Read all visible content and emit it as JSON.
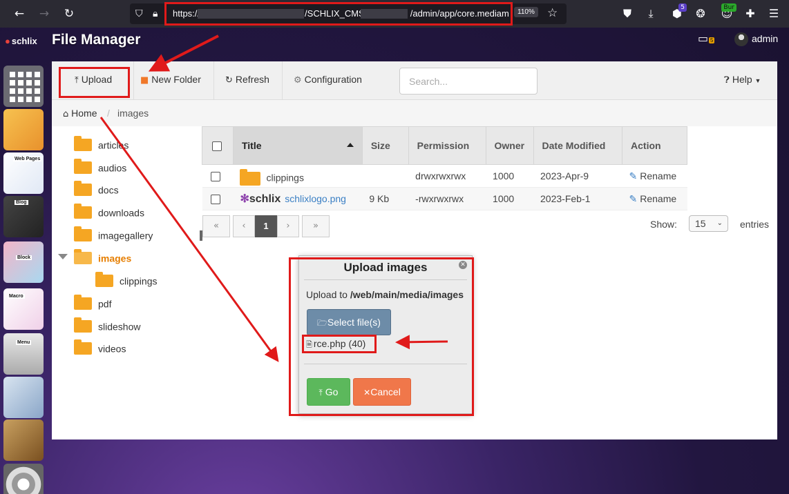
{
  "browser": {
    "url_prefix": "https://",
    "url_mid": "/SCHLIX_CMS",
    "url_suffix": "/admin/app/core.mediam",
    "zoom": "110%",
    "badges": {
      "extension_count": "5",
      "burp_label": "Bur"
    }
  },
  "app": {
    "logo_text": "schlix",
    "title": "File Manager",
    "monitor_badge": "5",
    "username": "admin"
  },
  "dock": {
    "items": [
      {
        "name": "apps",
        "label": ""
      },
      {
        "name": "file-manager",
        "label": ""
      },
      {
        "name": "web-pages",
        "label": "Web Pages"
      },
      {
        "name": "blog",
        "label": "Blog"
      },
      {
        "name": "block",
        "label": "Block"
      },
      {
        "name": "macro",
        "label": "Macro"
      },
      {
        "name": "menu",
        "label": "Menu"
      },
      {
        "name": "users",
        "label": ""
      },
      {
        "name": "tools",
        "label": ""
      },
      {
        "name": "settings",
        "label": ""
      }
    ]
  },
  "toolbar": {
    "upload_label": "Upload",
    "new_folder_label": "New Folder",
    "refresh_label": "Refresh",
    "configuration_label": "Configuration",
    "search_placeholder": "Search...",
    "help_label": "Help"
  },
  "breadcrumb": {
    "home": "Home",
    "current": "images"
  },
  "tree": {
    "items": [
      {
        "label": "articles",
        "level": 0,
        "expanded": false,
        "active": false
      },
      {
        "label": "audios",
        "level": 0,
        "expanded": false,
        "active": false
      },
      {
        "label": "docs",
        "level": 0,
        "expanded": false,
        "active": false
      },
      {
        "label": "downloads",
        "level": 0,
        "expanded": false,
        "active": false
      },
      {
        "label": "imagegallery",
        "level": 0,
        "expanded": false,
        "active": false
      },
      {
        "label": "images",
        "level": 0,
        "expanded": true,
        "active": true
      },
      {
        "label": "clippings",
        "level": 1,
        "expanded": false,
        "active": false
      },
      {
        "label": "pdf",
        "level": 0,
        "expanded": false,
        "active": false
      },
      {
        "label": "slideshow",
        "level": 0,
        "expanded": false,
        "active": false
      },
      {
        "label": "videos",
        "level": 0,
        "expanded": false,
        "active": false
      }
    ]
  },
  "table": {
    "columns": [
      "Title",
      "Size",
      "Permission",
      "Owner",
      "Date Modified",
      "Action"
    ],
    "rows": [
      {
        "type": "folder",
        "title": "clippings",
        "size": "",
        "permission": "drwxrwxrwx",
        "owner": "1000",
        "modified": "2023-Apr-9",
        "action": "Rename"
      },
      {
        "type": "image",
        "thumb_text": "schlix",
        "title": "schlixlogo.png",
        "size": "9 Kb",
        "permission": "-rwxrwxrwx",
        "owner": "1000",
        "modified": "2023-Feb-1",
        "action": "Rename"
      }
    ]
  },
  "pagination": {
    "first": "«",
    "prev": "‹",
    "current": "1",
    "next": "›",
    "last": "»",
    "show_label": "Show:",
    "page_size": "15",
    "entries_label": "entries"
  },
  "modal": {
    "title": "Upload images",
    "upload_to_prefix": "Upload to ",
    "upload_path": "/web/main/media/images",
    "select_label": "Select file(s)",
    "file_name": "rce.php (40)",
    "go_label": "Go",
    "cancel_label": "Cancel"
  },
  "colors": {
    "annotation_red": "#e01a1a",
    "folder_orange": "#f5a623",
    "active_tree": "#e67e00",
    "link_blue": "#3a7fc4",
    "go_green": "#5cb85c",
    "cancel_orange": "#f0774a"
  }
}
